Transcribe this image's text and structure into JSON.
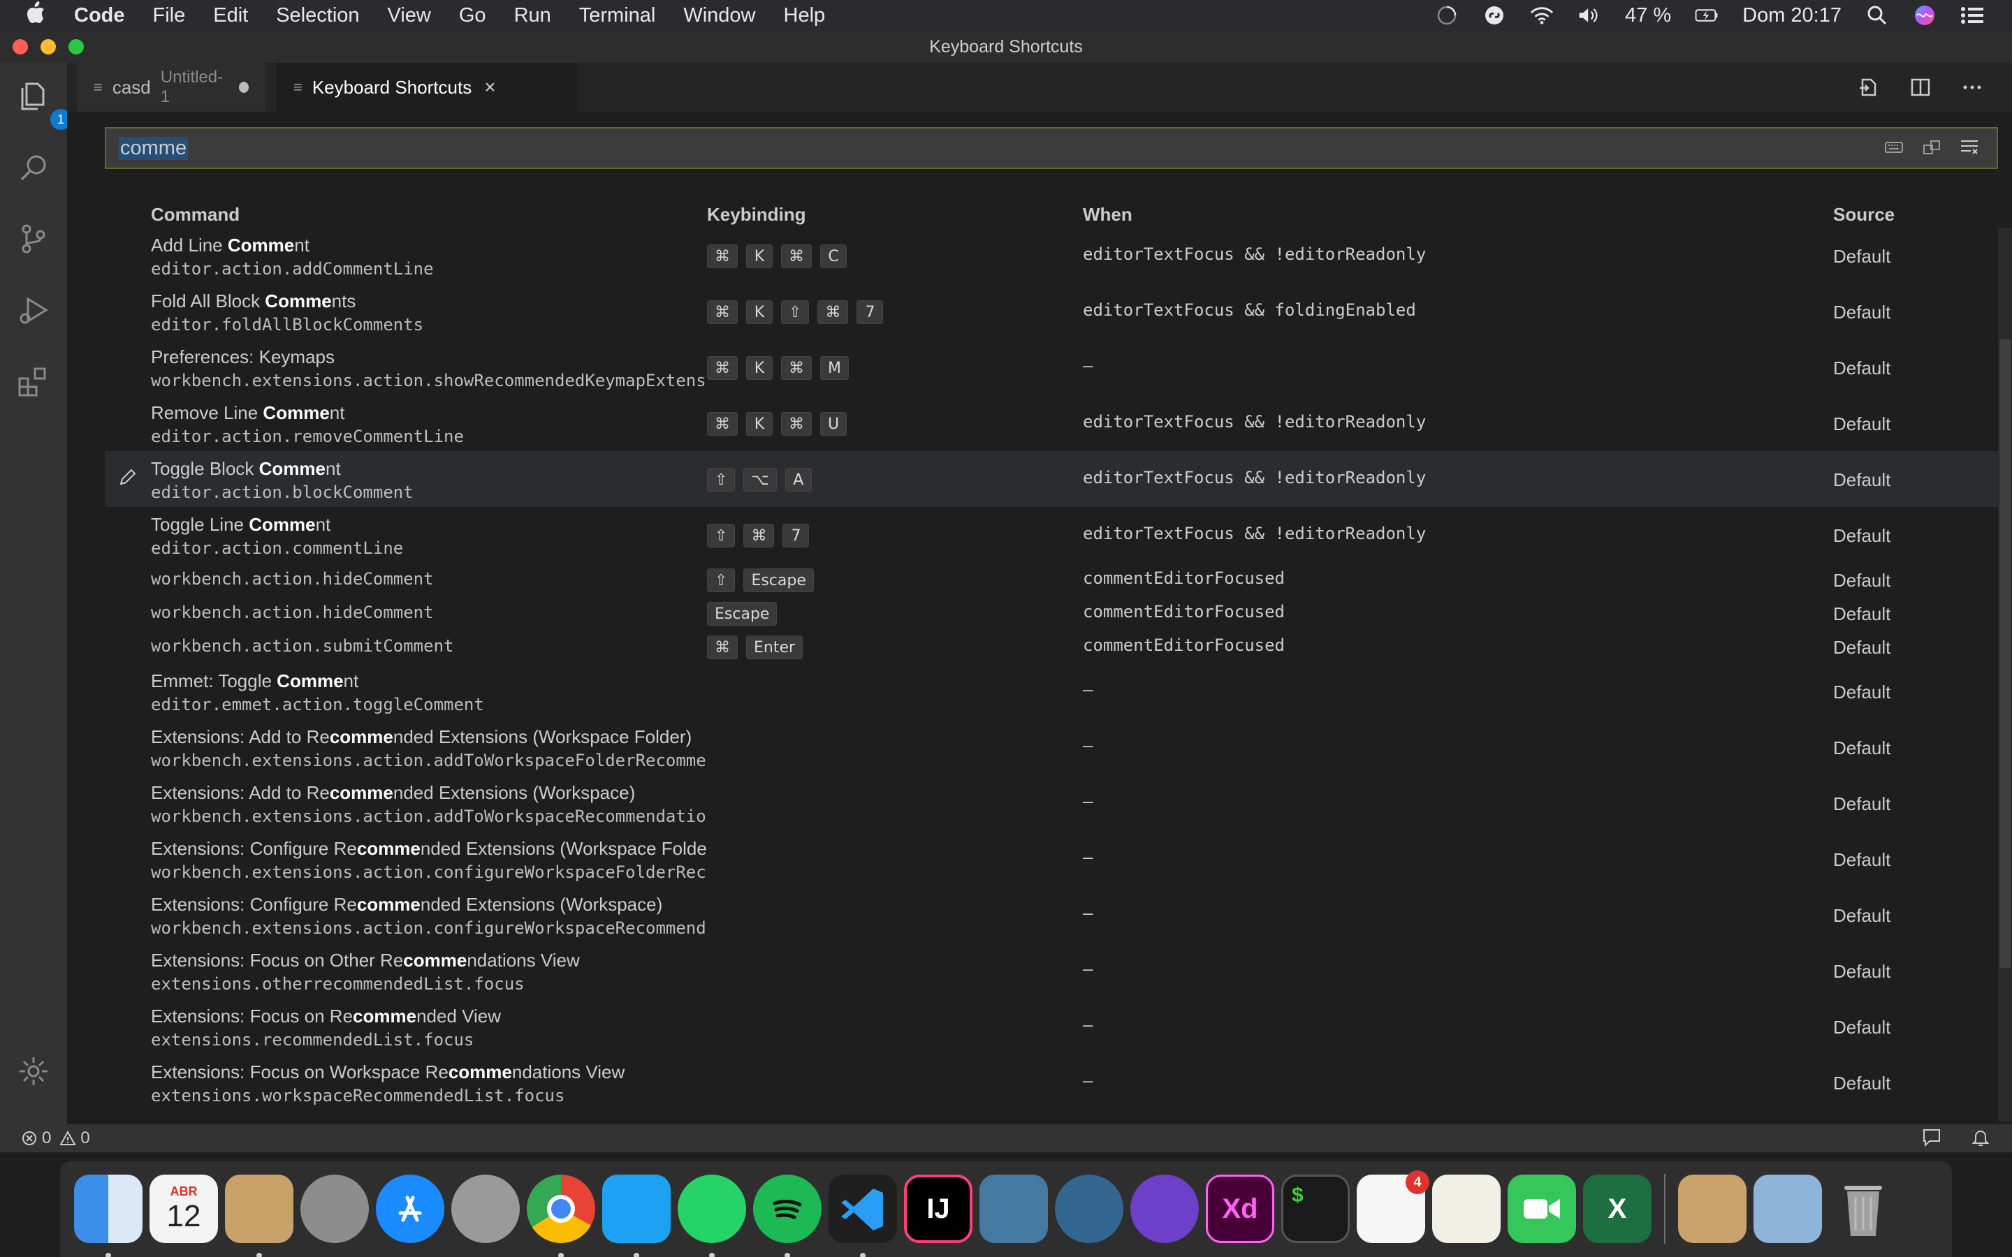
{
  "menubar": {
    "items": [
      "Code",
      "File",
      "Edit",
      "Selection",
      "View",
      "Go",
      "Run",
      "Terminal",
      "Window",
      "Help"
    ],
    "battery": "47 %",
    "clock": "Dom 20:17"
  },
  "window": {
    "title": "Keyboard Shortcuts"
  },
  "activity": {
    "explorer_badge": "1"
  },
  "tabs": [
    {
      "label": "casd",
      "sub": "Untitled-1"
    },
    {
      "label": "Keyboard Shortcuts"
    }
  ],
  "search": {
    "value": "comme"
  },
  "columns": {
    "command": "Command",
    "keybinding": "Keybinding",
    "when": "When",
    "source": "Source"
  },
  "rows": [
    {
      "title_pre": "Add Line ",
      "title_bold": "Comme",
      "title_post": "nt",
      "id": "editor.action.addCommentLine",
      "keys": [
        "⌘",
        "K",
        "⌘",
        "C"
      ],
      "when": "editorTextFocus && !editorReadonly",
      "source": "Default"
    },
    {
      "title_pre": "Fold All Block ",
      "title_bold": "Comme",
      "title_post": "nts",
      "id": "editor.foldAllBlockComments",
      "keys": [
        "⌘",
        "K",
        "⇧",
        "⌘",
        "7"
      ],
      "when": "editorTextFocus && foldingEnabled",
      "source": "Default"
    },
    {
      "title_pre": "Preferences: Keymaps",
      "title_bold": "",
      "title_post": "",
      "id": "workbench.extensions.action.showRecommendedKeymapExtensic",
      "keys": [
        "⌘",
        "K",
        "⌘",
        "M"
      ],
      "when": "—",
      "source": "Default"
    },
    {
      "title_pre": "Remove Line ",
      "title_bold": "Comme",
      "title_post": "nt",
      "id": "editor.action.removeCommentLine",
      "keys": [
        "⌘",
        "K",
        "⌘",
        "U"
      ],
      "when": "editorTextFocus && !editorReadonly",
      "source": "Default"
    },
    {
      "title_pre": "Toggle Block ",
      "title_bold": "Comme",
      "title_post": "nt",
      "id": "editor.action.blockComment",
      "keys": [
        "⇧",
        "⌥",
        "A"
      ],
      "when": "editorTextFocus && !editorReadonly",
      "source": "Default"
    },
    {
      "title_pre": "Toggle Line ",
      "title_bold": "Comme",
      "title_post": "nt",
      "id": "editor.action.commentLine",
      "keys": [
        "⇧",
        "⌘",
        "7"
      ],
      "when": "editorTextFocus && !editorReadonly",
      "source": "Default"
    },
    {
      "id": "workbench.action.hideComment",
      "keys": [
        "⇧",
        "Escape"
      ],
      "when": "commentEditorFocused",
      "source": "Default"
    },
    {
      "id": "workbench.action.hideComment",
      "keys": [
        "Escape"
      ],
      "when": "commentEditorFocused",
      "source": "Default"
    },
    {
      "id": "workbench.action.submitComment",
      "keys": [
        "⌘",
        "Enter"
      ],
      "when": "commentEditorFocused",
      "source": "Default"
    },
    {
      "title_pre": "Emmet: Toggle ",
      "title_bold": "Comme",
      "title_post": "nt",
      "id": "editor.emmet.action.toggleComment",
      "keys": [],
      "when": "—",
      "source": "Default"
    },
    {
      "title_pre": "Extensions: Add to Re",
      "title_bold": "comme",
      "title_post": "nded Extensions (Workspace Folder)",
      "id": "workbench.extensions.action.addToWorkspaceFolderRecommenc",
      "keys": [],
      "when": "—",
      "source": "Default"
    },
    {
      "title_pre": "Extensions: Add to Re",
      "title_bold": "comme",
      "title_post": "nded Extensions (Workspace)",
      "id": "workbench.extensions.action.addToWorkspaceRecommendations",
      "keys": [],
      "when": "—",
      "source": "Default"
    },
    {
      "title_pre": "Extensions: Configure Re",
      "title_bold": "comme",
      "title_post": "nded Extensions (Workspace Folder)",
      "id": "workbench.extensions.action.configureWorkspaceFolderRecom",
      "keys": [],
      "when": "—",
      "source": "Default"
    },
    {
      "title_pre": "Extensions: Configure Re",
      "title_bold": "comme",
      "title_post": "nded Extensions (Workspace)",
      "id": "workbench.extensions.action.configureWorkspaceRecommendec",
      "keys": [],
      "when": "—",
      "source": "Default"
    },
    {
      "title_pre": "Extensions: Focus on Other Re",
      "title_bold": "comme",
      "title_post": "ndations View",
      "id": "extensions.otherrecommendedList.focus",
      "keys": [],
      "when": "—",
      "source": "Default"
    },
    {
      "title_pre": "Extensions: Focus on Re",
      "title_bold": "comme",
      "title_post": "nded View",
      "id": "extensions.recommendedList.focus",
      "keys": [],
      "when": "—",
      "source": "Default"
    },
    {
      "title_pre": "Extensions: Focus on Workspace Re",
      "title_bold": "comme",
      "title_post": "ndations View",
      "id": "extensions.workspaceRecommendedList.focus",
      "keys": [],
      "when": "—",
      "source": "Default"
    }
  ],
  "status": {
    "errors": "0",
    "warnings": "0"
  },
  "dock": {
    "calendar_month": "ABR",
    "calendar_day": "12",
    "intellij": "IJ",
    "xd": "Xd",
    "terminal": "$",
    "excel": "X",
    "reminders_badge": "4"
  }
}
